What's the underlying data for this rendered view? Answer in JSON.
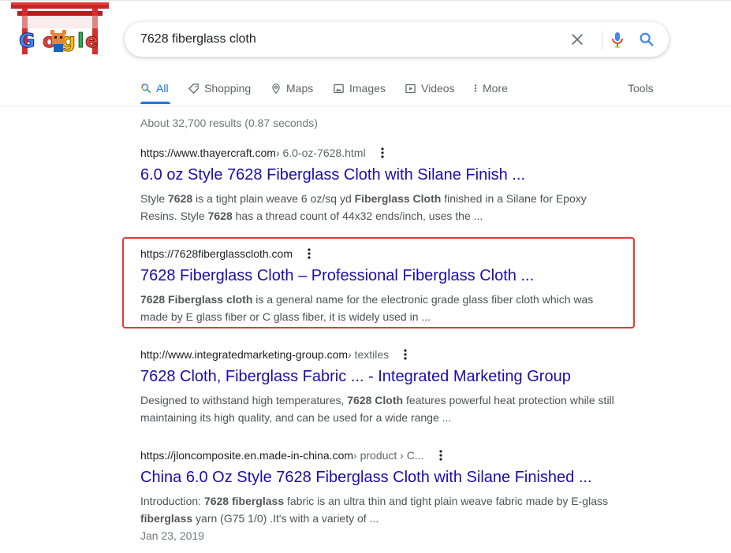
{
  "search": {
    "query": "7628 fiberglass cloth"
  },
  "tabs": [
    {
      "label": "All",
      "icon": "search-icon",
      "active": true
    },
    {
      "label": "Shopping",
      "icon": "tag-icon"
    },
    {
      "label": "Maps",
      "icon": "map-pin-icon"
    },
    {
      "label": "Images",
      "icon": "image-icon"
    },
    {
      "label": "Videos",
      "icon": "video-icon"
    },
    {
      "label": "More",
      "icon": "more-vert-icon"
    }
  ],
  "tools_label": "Tools",
  "stats": "About 32,700 results (0.87 seconds)",
  "results": [
    {
      "url": "https://www.thayercraft.com",
      "crumb": " › 6.0-oz-7628.html",
      "title": "6.0 oz Style 7628 Fiberglass Cloth with Silane Finish ...",
      "snippet_parts": [
        {
          "t": "Style "
        },
        {
          "b": "7628"
        },
        {
          "t": " is a tight plain weave 6 oz/sq yd "
        },
        {
          "b": "Fiberglass Cloth"
        },
        {
          "t": " finished in a Silane for Epoxy Resins. Style "
        },
        {
          "b": "7628"
        },
        {
          "t": " has a thread count of 44x32 ends/inch, uses the ..."
        }
      ]
    },
    {
      "url": "https://7628fiberglasscloth.com",
      "crumb": "",
      "title": "7628 Fiberglass Cloth – Professional Fiberglass Cloth ...",
      "snippet_parts": [
        {
          "b": "7628 Fiberglass cloth"
        },
        {
          "t": " is a general name for the electronic grade glass fiber cloth which was made by E glass fiber or C glass fiber, it is widely used in ..."
        }
      ]
    },
    {
      "url": "http://www.integratedmarketing-group.com",
      "crumb": " › textiles",
      "title": "7628 Cloth, Fiberglass Fabric ... - Integrated Marketing Group",
      "snippet_parts": [
        {
          "t": "Designed to withstand high temperatures, "
        },
        {
          "b": "7628 Cloth"
        },
        {
          "t": " features powerful heat protection while still maintaining its high quality, and can be used for a wide range ..."
        }
      ]
    },
    {
      "url": "https://jloncomposite.en.made-in-china.com",
      "crumb": " › product › C...",
      "title": "China 6.0 Oz Style 7628 Fiberglass Cloth with Silane Finished ...",
      "snippet_parts": [
        {
          "t": "Introduction: "
        },
        {
          "b": "7628 fiberglass"
        },
        {
          "t": " fabric is an ultra thin and tight plain weave fabric made by E-glass "
        },
        {
          "b": "fiberglass"
        },
        {
          "t": " yarn (G75 1/0) .It's with a variety of ..."
        }
      ],
      "date": "Jan 23, 2019"
    }
  ],
  "colors": {
    "link": "#1a0dab",
    "accent": "#1a73e8",
    "highlight": "#e53935"
  }
}
